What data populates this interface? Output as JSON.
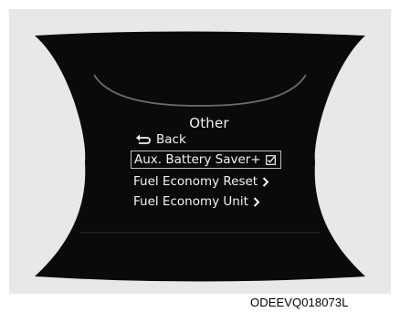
{
  "menu": {
    "title": "Other",
    "back_label": "Back",
    "items": [
      {
        "label": "Aux. Battery Saver+",
        "icon": "checkbox-icon",
        "selected": true
      },
      {
        "label": "Fuel Economy Reset",
        "icon": "chevron-right-icon",
        "selected": false
      },
      {
        "label": "Fuel Economy Unit",
        "icon": "chevron-right-icon",
        "selected": false
      }
    ]
  },
  "caption": "ODEEVQ018073L",
  "colors": {
    "frame_background": "#e8e8e8",
    "display_background": "#0a0a0a",
    "text": "#f2f2f2",
    "selection_border": "#bdbdbd"
  }
}
